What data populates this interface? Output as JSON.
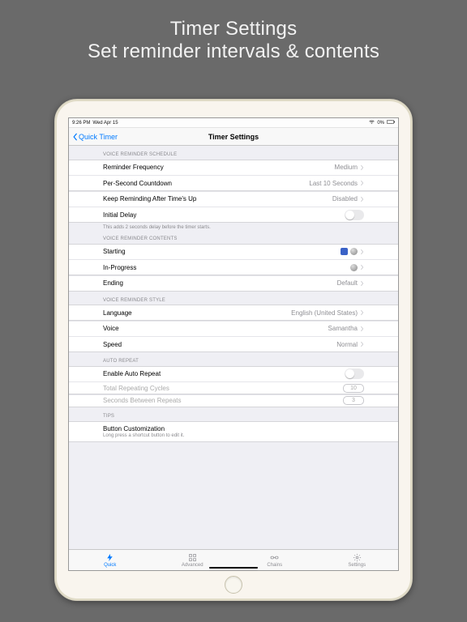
{
  "hero": {
    "line1": "Timer Settings",
    "line2": "Set reminder intervals & contents"
  },
  "statusbar": {
    "time": "9:26 PM",
    "date": "Wed Apr 15",
    "wifi": "􀙇",
    "battery_pct": "0%"
  },
  "navbar": {
    "back_label": "Quick Timer",
    "title": "Timer Settings"
  },
  "sections": {
    "schedule_header": "VOICE REMINDER SCHEDULE",
    "reminder_frequency": {
      "label": "Reminder Frequency",
      "value": "Medium"
    },
    "per_second_countdown": {
      "label": "Per-Second Countdown",
      "value": "Last 10 Seconds"
    },
    "keep_reminding": {
      "label": "Keep Reminding After Time's Up",
      "value": "Disabled"
    },
    "initial_delay": {
      "label": "Initial Delay",
      "on": false
    },
    "initial_delay_footer": "This adds 2 seconds delay before the timer starts.",
    "contents_header": "VOICE REMINDER CONTENTS",
    "starting": {
      "label": "Starting"
    },
    "in_progress": {
      "label": "In-Progress"
    },
    "ending": {
      "label": "Ending",
      "value": "Default"
    },
    "style_header": "VOICE REMINDER STYLE",
    "language": {
      "label": "Language",
      "value": "English (United States)"
    },
    "voice": {
      "label": "Voice",
      "value": "Samantha"
    },
    "speed": {
      "label": "Speed",
      "value": "Normal"
    },
    "autorepeat_header": "AUTO REPEAT",
    "enable_auto_repeat": {
      "label": "Enable Auto Repeat",
      "on": false
    },
    "total_cycles": {
      "label": "Total Repeating Cycles",
      "value": "10"
    },
    "seconds_between": {
      "label": "Seconds Between Repeats",
      "value": "3"
    },
    "tips_header": "TIPS",
    "tips": {
      "title": "Button Customization",
      "subtitle": "Long press a shortcut button to edit it."
    }
  },
  "tabs": {
    "quick": "Quick",
    "advanced": "Advanced",
    "chains": "Chains",
    "settings": "Settings"
  }
}
